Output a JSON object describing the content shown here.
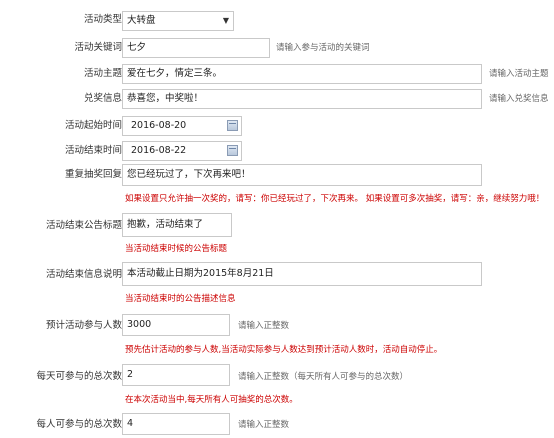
{
  "fields": {
    "activity_type": {
      "label": "活动类型",
      "value": "大转盘"
    },
    "keyword": {
      "label": "活动关键词",
      "value": "七夕",
      "hint": "请输入参与活动的关键词"
    },
    "subject": {
      "label": "活动主题",
      "value": "爱在七夕，情定三条。",
      "hint": "请输入活动主题"
    },
    "prize_info": {
      "label": "兑奖信息",
      "value": "恭喜您，中奖啦！",
      "hint": "请输入兑奖信息"
    },
    "start_time": {
      "label": "活动起始时间",
      "value": "2016-08-20"
    },
    "end_time": {
      "label": "活动结束时间",
      "value": "2016-08-22"
    },
    "repeat_reply": {
      "label": "重复抽奖回复",
      "value": "您已经玩过了，下次再来吧！",
      "note": "如果设置只允许抽一次奖的，请写：你已经玩过了，下次再来。 如果设置可多次抽奖，请写：亲，继续努力哦！"
    },
    "end_title": {
      "label": "活动结束公告标题",
      "value": "抱歉，活动结束了",
      "note": "当活动结束时候的公告标题"
    },
    "end_desc": {
      "label": "活动结束信息说明",
      "value": "本活动截止日期为2015年8月21日",
      "note": "当活动结束时的公告描述信息"
    },
    "expected_participants": {
      "label": "预计活动参与人数",
      "value": "3000",
      "hint": "请输入正整数",
      "note": "预先估计活动的参与人数,当活动实际参与人数达到预计活动人数时，活动自动停止。"
    },
    "daily_total": {
      "label": "每天可参与的总次数",
      "value": "2",
      "hint": "请输入正整数（每天所有人可参与的总次数）",
      "note": "在本次活动当中,每天所有人可抽奖的总次数。"
    },
    "per_person_total": {
      "label": "每人可参与的总次数",
      "value": "4",
      "hint": "请输入正整数"
    }
  }
}
